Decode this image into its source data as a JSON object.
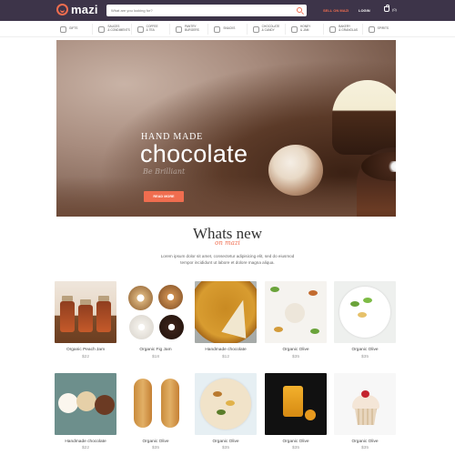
{
  "header": {
    "logo_text": "mazi",
    "search_placeholder": "What are you looking for?",
    "sell_label": "SELL ON MAZI",
    "login_label": "LOGIN",
    "cart_count": "(0)"
  },
  "categories": [
    {
      "label": "GIFTS",
      "icon": "gift-icon"
    },
    {
      "label": "SAUCES\n& CONDIMENTS",
      "icon": "sauce-icon"
    },
    {
      "label": "COFFEE\n& TEA",
      "icon": "coffee-icon"
    },
    {
      "label": "PANTRY\nBURGERS",
      "icon": "pantry-icon"
    },
    {
      "label": "SNACKS",
      "icon": "snack-icon"
    },
    {
      "label": "CHOCOLATE\n& CANDY",
      "icon": "chocolate-icon"
    },
    {
      "label": "HONEY\n& JAM",
      "icon": "honey-icon"
    },
    {
      "label": "BAKERY\n& GRANOLAS",
      "icon": "bakery-icon"
    },
    {
      "label": "SPIRITS",
      "icon": "spirits-icon"
    }
  ],
  "hero": {
    "kicker": "HAND MADE",
    "title": "chocolate",
    "script": "Be Brilliant",
    "button_label": "READ MORE"
  },
  "section": {
    "title": "Whats new",
    "subtitle": "on mazi",
    "description": "Lorem ipsum dolor sit amet, consectetur adipisicing elit, sed do eiusmod tempor incididunt ut labore et dolore magna aliqua."
  },
  "products_row1": [
    {
      "name": "Organic Peach Jam",
      "price": "$22"
    },
    {
      "name": "Organic Fig Jam",
      "price": "$18"
    },
    {
      "name": "Handmade chocolate",
      "price": "$12"
    },
    {
      "name": "Organic Olive",
      "price": "$35"
    },
    {
      "name": "Organic Olive",
      "price": "$35"
    }
  ],
  "products_row2": [
    {
      "name": "Handmade chocolate",
      "price": "$22"
    },
    {
      "name": "Organic Olive",
      "price": "$35"
    },
    {
      "name": "Organic Olive",
      "price": "$35"
    },
    {
      "name": "Organic Olive",
      "price": "$35"
    },
    {
      "name": "Organic Olive",
      "price": "$35"
    }
  ],
  "colors": {
    "topbar": "#3d3449",
    "accent": "#f06d4f"
  }
}
